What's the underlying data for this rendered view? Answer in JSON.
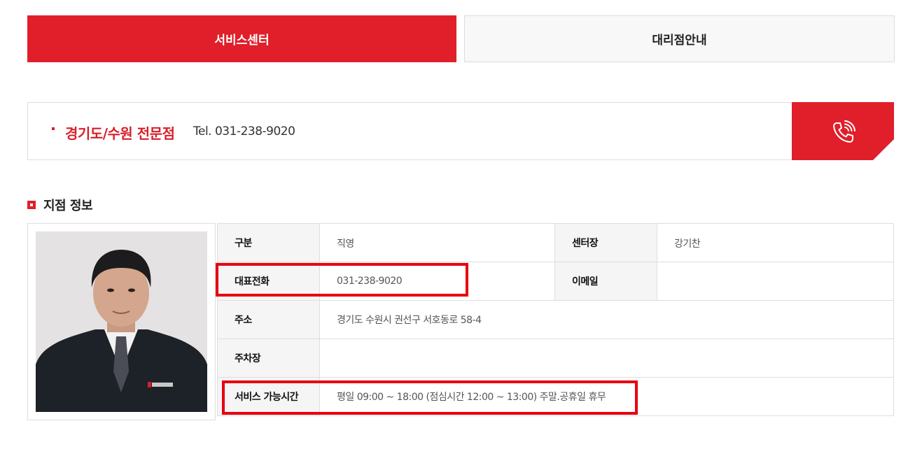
{
  "tabs": [
    {
      "label": "서비스센터",
      "active": true
    },
    {
      "label": "대리점안내",
      "active": false
    }
  ],
  "branch": {
    "name": "경기도/수원 전문점",
    "tel": "Tel. 031-238-9020"
  },
  "section": {
    "title": "지점 정보"
  },
  "info": {
    "type_label": "구분",
    "type_value": "직영",
    "manager_label": "센터장",
    "manager_value": "강기찬",
    "phone_label": "대표전화",
    "phone_value": "031-238-9020",
    "email_label": "이메일",
    "email_value": "",
    "address_label": "주소",
    "address_value": "경기도 수원시 권선구 서호동로 58-4",
    "parking_label": "주차장",
    "parking_value": "",
    "hours_label": "서비스 가능시간",
    "hours_value": "평일 09:00 ~ 18:00 (점심시간 12:00 ~ 13:00) 주말.공휴일 휴무"
  },
  "colors": {
    "accent": "#e01f2a",
    "highlight": "#e8000f"
  }
}
